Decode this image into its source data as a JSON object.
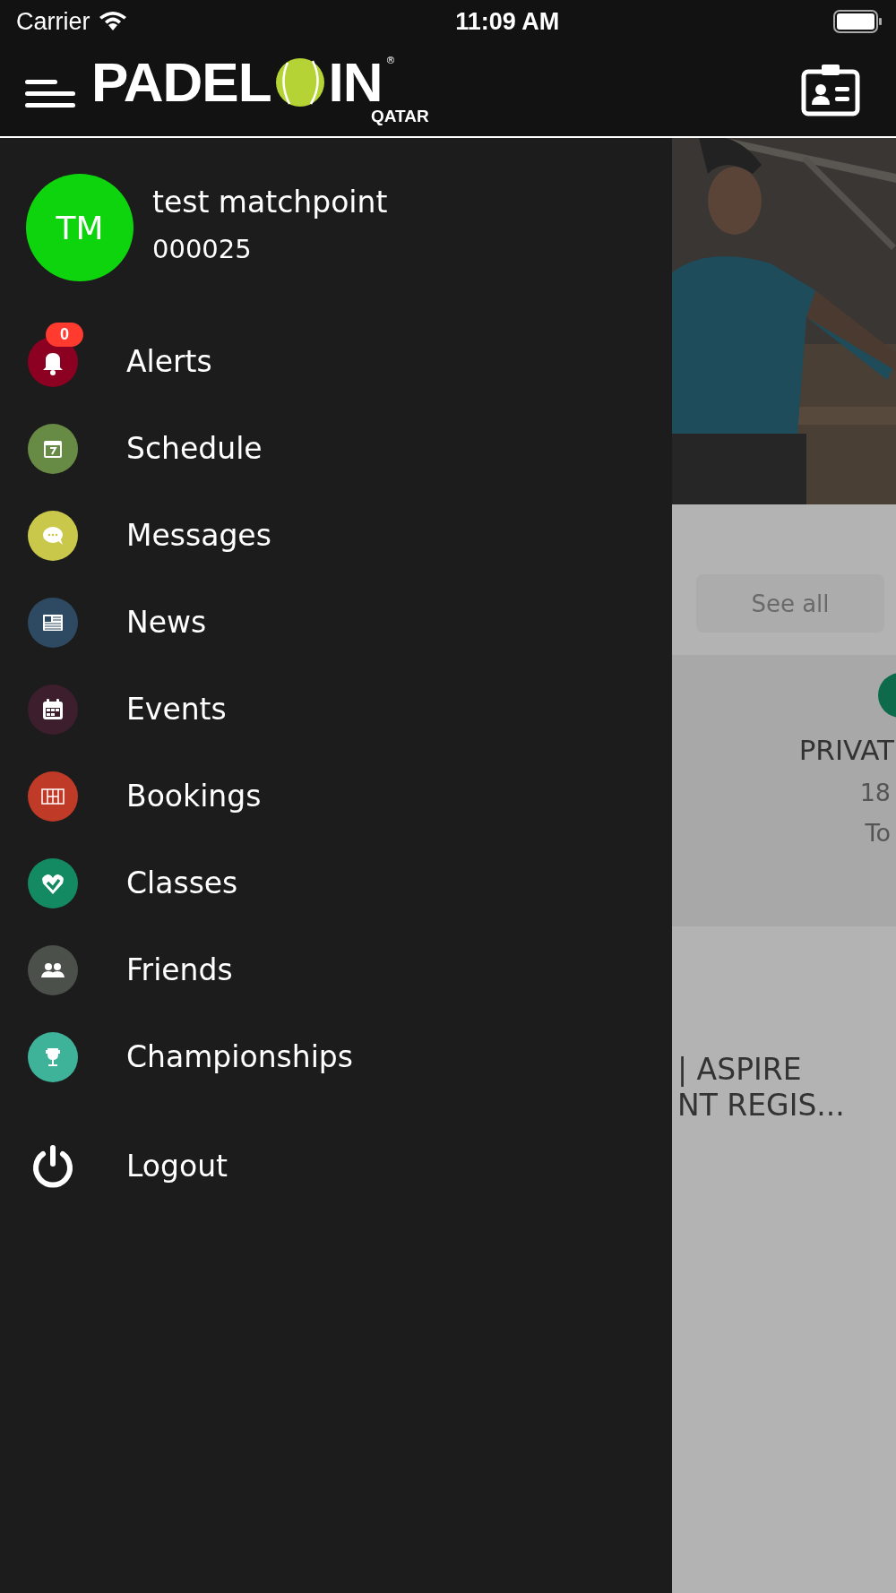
{
  "status_bar": {
    "carrier": "Carrier",
    "time": "11:09 AM"
  },
  "header": {
    "logo": {
      "word_1": "PADEL",
      "word_2": "IN",
      "subtitle": "QATAR",
      "mark": "®"
    }
  },
  "profile": {
    "initials": "TM",
    "name": "test matchpoint",
    "member_number": "000025"
  },
  "menu": [
    {
      "label": "Alerts",
      "kind": "bell",
      "color": "#8c0022",
      "badge": "0"
    },
    {
      "label": "Schedule",
      "kind": "day",
      "color": "#678a44"
    },
    {
      "label": "Messages",
      "kind": "chat",
      "color": "#c9c84a"
    },
    {
      "label": "News",
      "kind": "newspaper",
      "color": "#2e4a62"
    },
    {
      "label": "Events",
      "kind": "calendar",
      "color": "#3c1e2d"
    },
    {
      "label": "Bookings",
      "kind": "court",
      "color": "#c03a28"
    },
    {
      "label": "Classes",
      "kind": "heart",
      "color": "#138a62"
    },
    {
      "label": "Friends",
      "kind": "people",
      "color": "#4b504b"
    },
    {
      "label": "Championships",
      "kind": "trophy",
      "color": "#3fb39a"
    }
  ],
  "logout": {
    "label": "Logout"
  },
  "background_page": {
    "see_all": "See all",
    "card": {
      "title": "PRIVAT",
      "line_1": "18",
      "line_2": "To"
    },
    "event_title_lines": [
      "| ASPIRE",
      "NT REGIS..."
    ]
  }
}
